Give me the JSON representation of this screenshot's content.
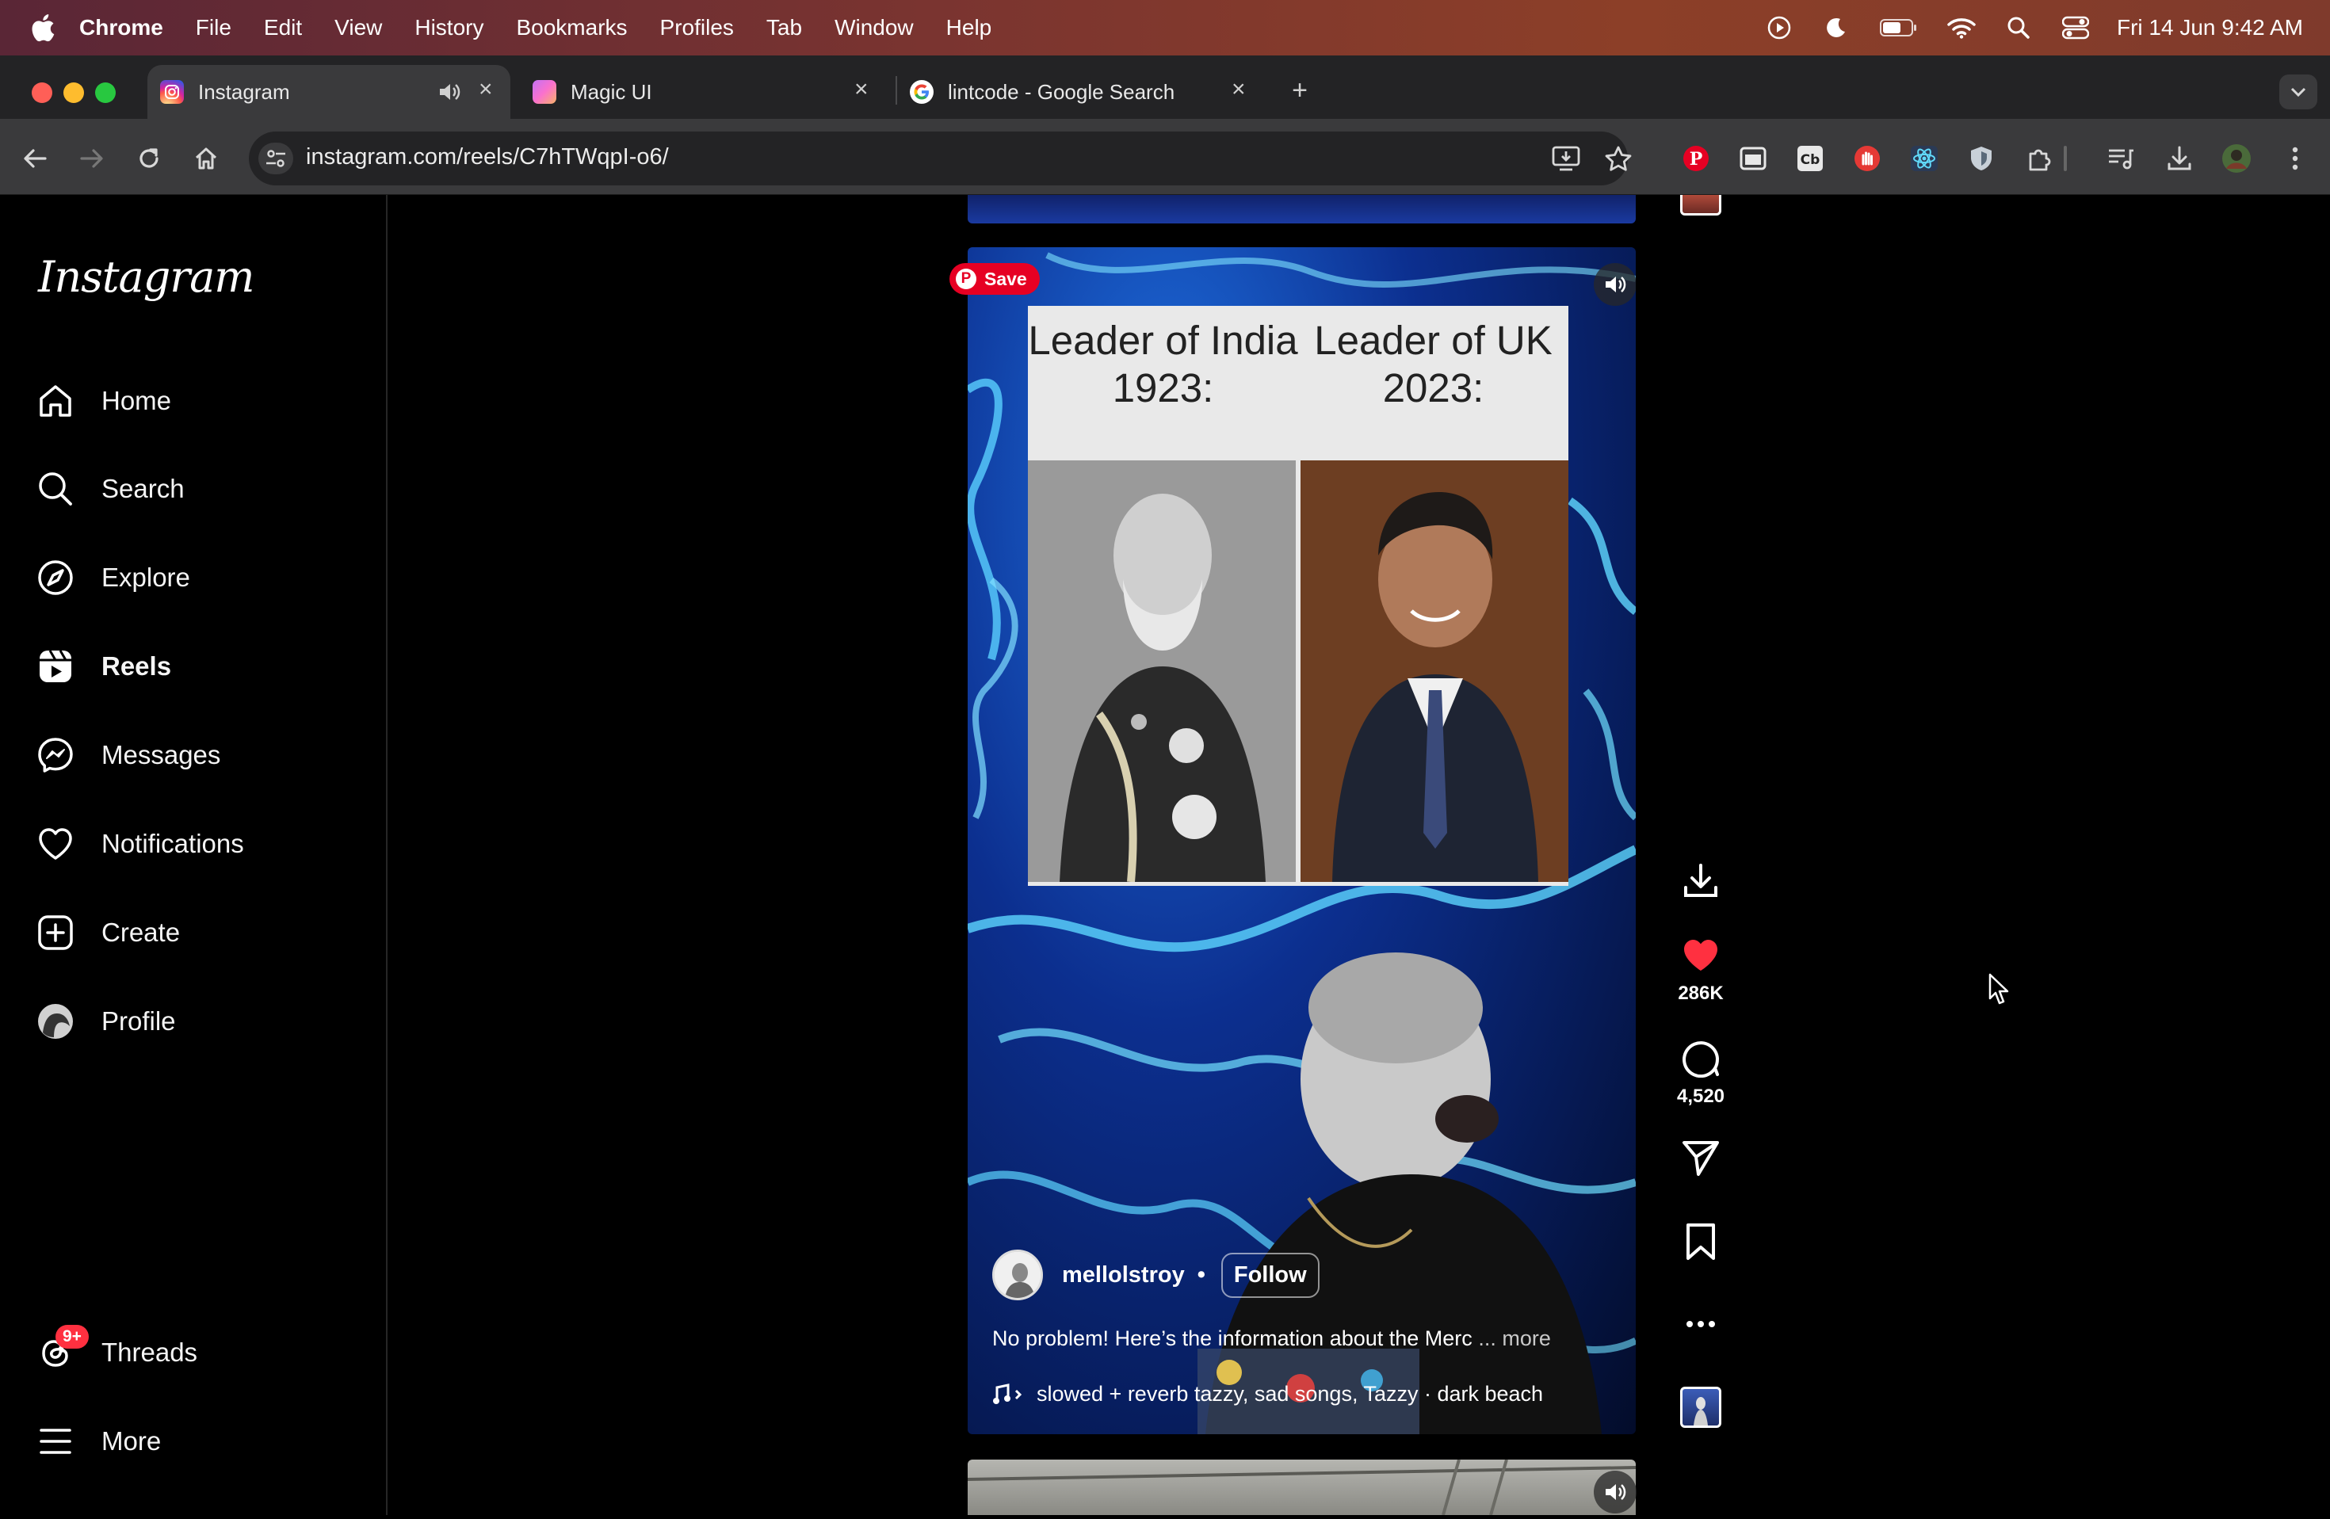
{
  "menubar": {
    "app": "Chrome",
    "items": [
      "File",
      "Edit",
      "View",
      "History",
      "Bookmarks",
      "Profiles",
      "Tab",
      "Window",
      "Help"
    ],
    "clock": "Fri 14 Jun  9:42 AM"
  },
  "tabs": [
    {
      "title": "Instagram",
      "icon": "instagram-icon"
    },
    {
      "title": "Magic UI",
      "icon": "magic-ui-icon"
    },
    {
      "title": "lintcode - Google Search",
      "icon": "google-icon"
    }
  ],
  "toolbar": {
    "url": "instagram.com/reels/C7hTWqpI-o6/"
  },
  "instagram": {
    "logo": "Instagram",
    "nav": {
      "home": "Home",
      "search": "Search",
      "explore": "Explore",
      "reels": "Reels",
      "messages": "Messages",
      "notifications": "Notifications",
      "create": "Create",
      "profile": "Profile",
      "threads": "Threads",
      "threads_badge": "9+",
      "more": "More"
    }
  },
  "reel": {
    "pinterest_save": "Save",
    "meme_left": "Leader of India 1923:",
    "meme_right": "Leader of UK 2023:",
    "username": "mellolstroy",
    "separator": "•",
    "follow": "Follow",
    "caption": "No problem! Here’s the information about the Merc",
    "caption_more": "... more",
    "audio": "slowed + reverb tazzy, sad songs, Tazzy · dark beach",
    "likes": "286K",
    "comments": "4,520"
  },
  "colors": {
    "like_red": "#ff3040",
    "pinterest_red": "#e60023",
    "badge_red": "#ff3040"
  }
}
